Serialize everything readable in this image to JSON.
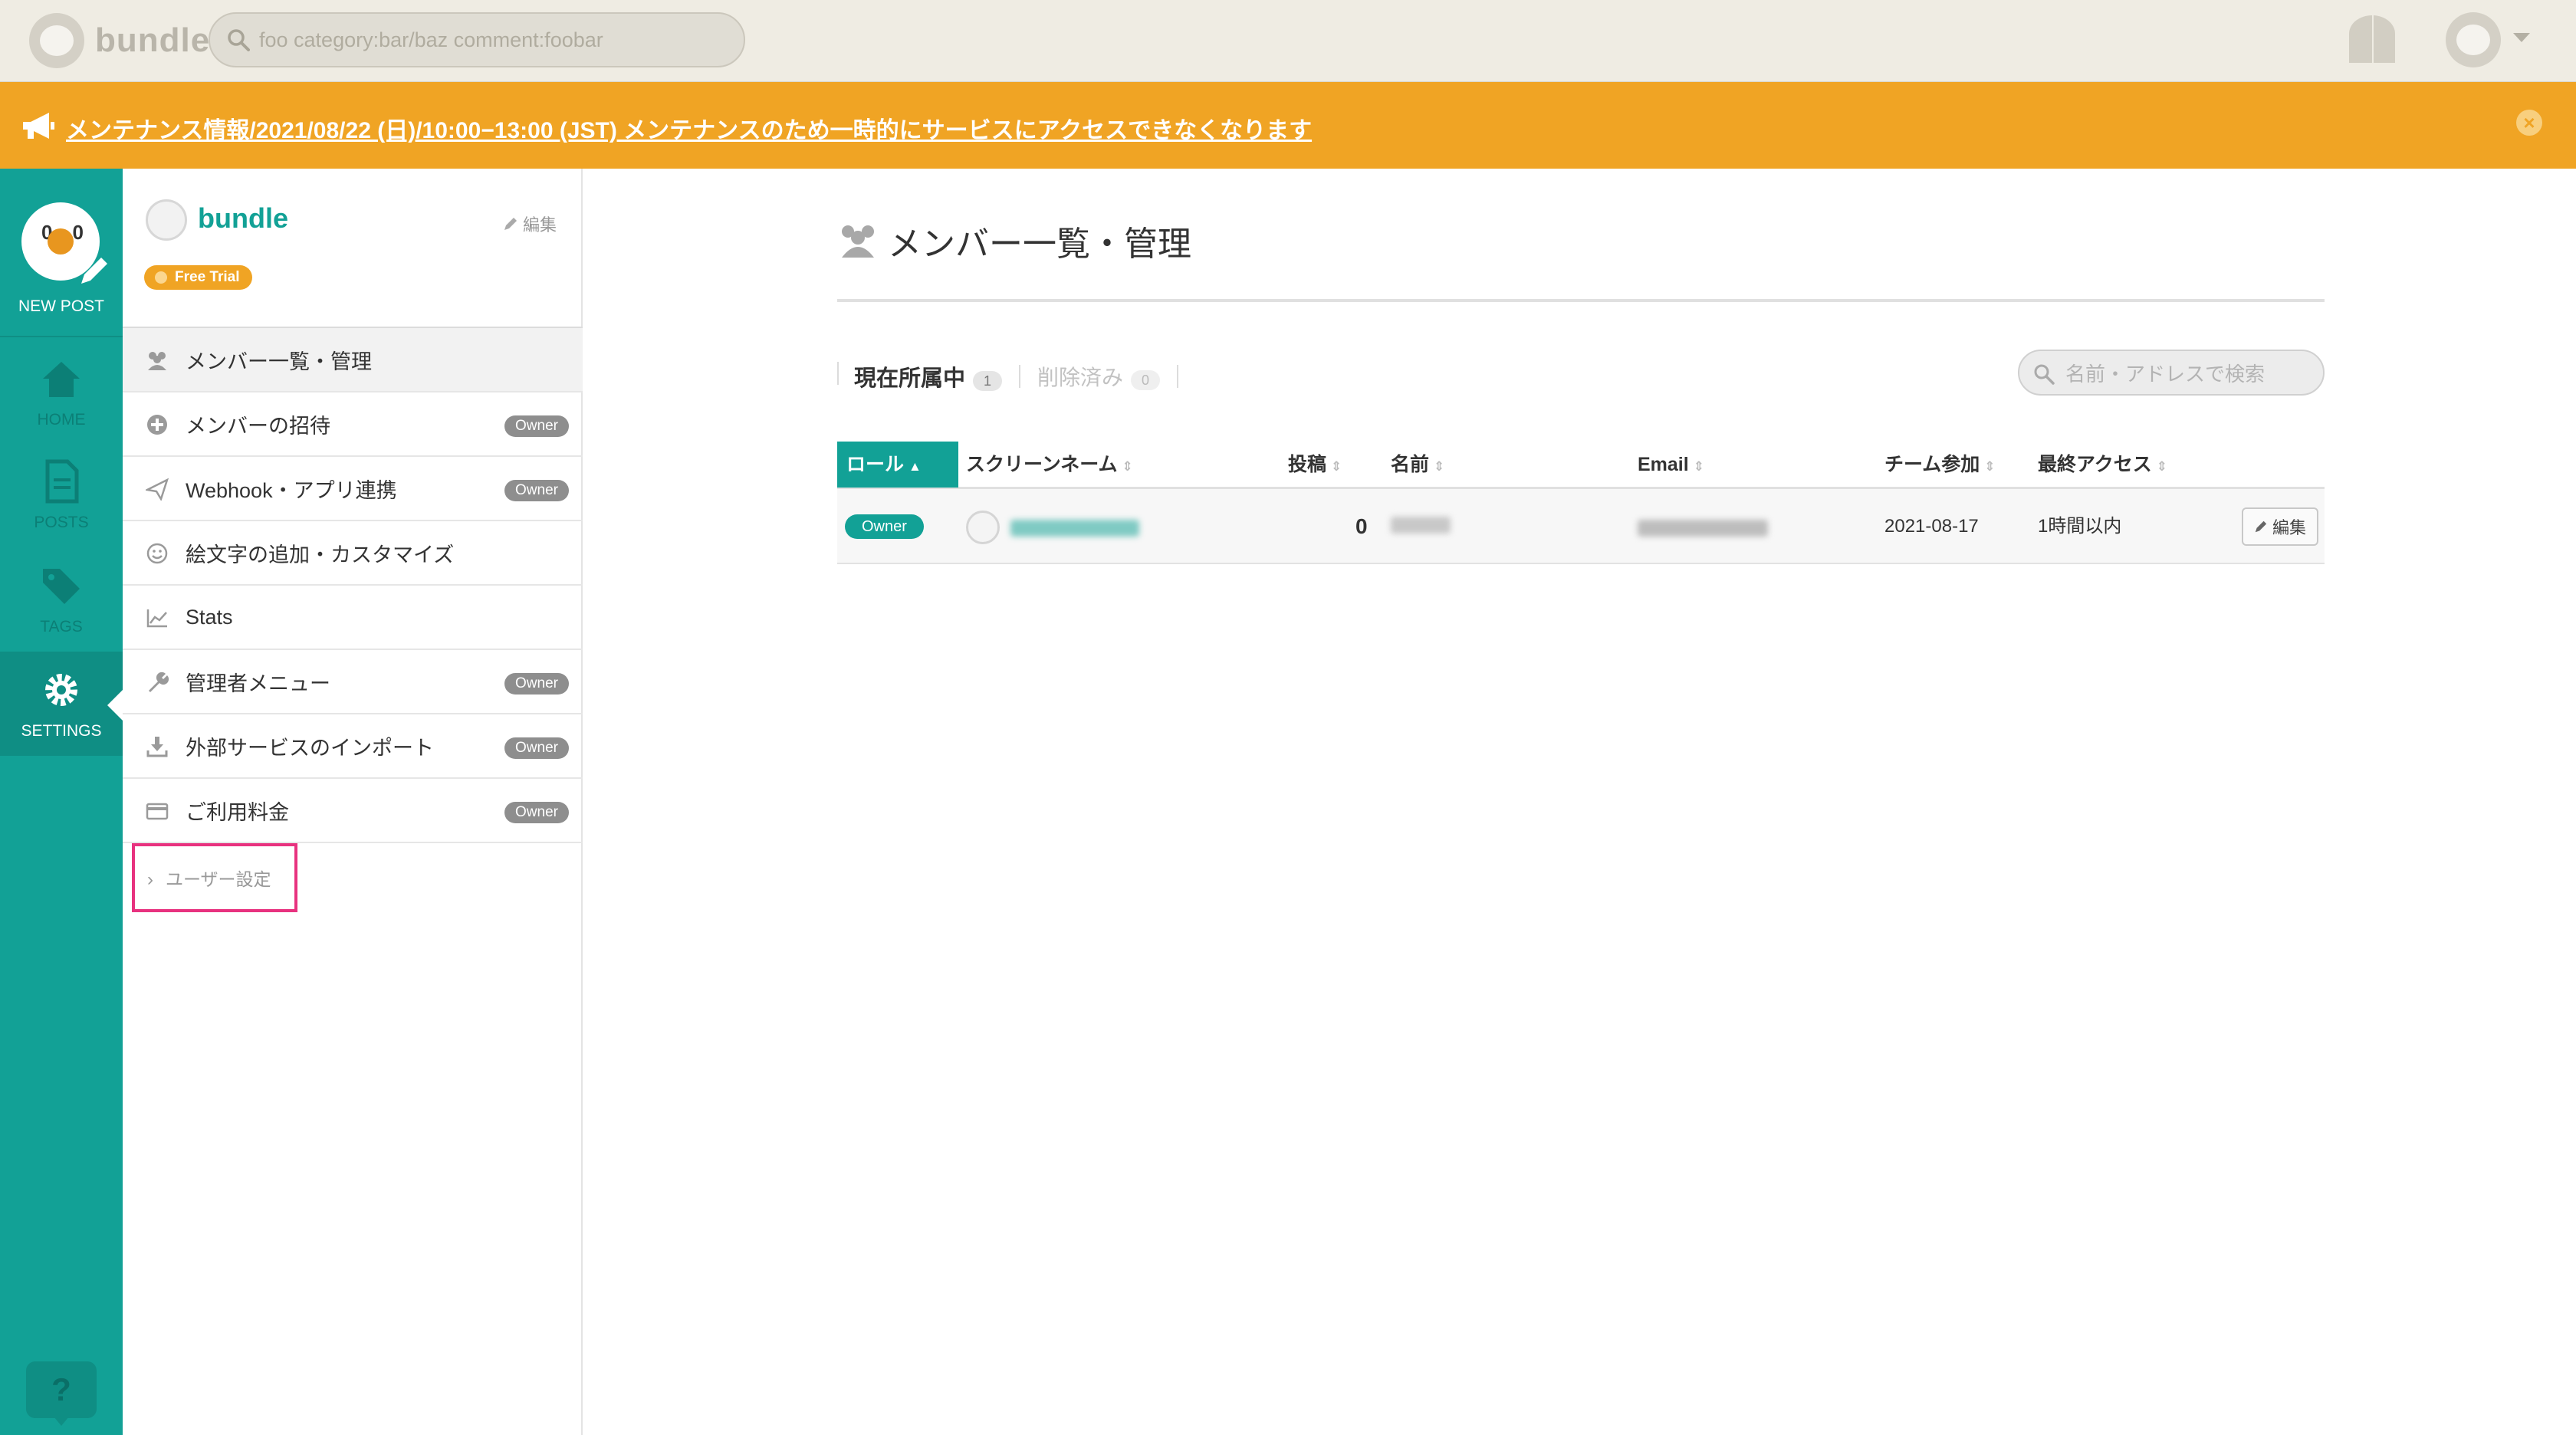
{
  "app": {
    "name": "bundle"
  },
  "topbar": {
    "search_placeholder": "foo category:bar/baz comment:foobar"
  },
  "banner": {
    "text": "メンテナンス情報/2021/08/22 (日)/10:00−13:00 (JST) メンテナンスのため一時的にサービスにアクセスできなくなります",
    "color": "#f0a424",
    "close_icon": "close-icon"
  },
  "rail": {
    "new_post": "NEW POST",
    "items": [
      {
        "label": "HOME",
        "icon": "home-icon"
      },
      {
        "label": "POSTS",
        "icon": "document-icon"
      },
      {
        "label": "TAGS",
        "icon": "tags-icon"
      },
      {
        "label": "SETTINGS",
        "icon": "gear-icon",
        "active": true
      }
    ],
    "help": "?",
    "accent": "#12a196"
  },
  "team": {
    "name": "bundle",
    "edit_label": "編集",
    "trial_badge": "Free Trial"
  },
  "menu": {
    "items": [
      {
        "label": "メンバー一覧・管理",
        "icon": "members-icon",
        "active": true
      },
      {
        "label": "メンバーの招待",
        "icon": "plus-circle-icon",
        "badge": "Owner"
      },
      {
        "label": "Webhook・アプリ連携",
        "icon": "paper-plane-icon",
        "badge": "Owner"
      },
      {
        "label": "絵文字の追加・カスタマイズ",
        "icon": "smiley-icon"
      },
      {
        "label": "Stats",
        "icon": "chart-icon"
      },
      {
        "label": "管理者メニュー",
        "icon": "wrench-icon",
        "badge": "Owner"
      },
      {
        "label": "外部サービスのインポート",
        "icon": "download-icon",
        "badge": "Owner"
      },
      {
        "label": "ご利用料金",
        "icon": "credit-card-icon",
        "badge": "Owner"
      }
    ],
    "user_settings": "ユーザー設定",
    "highlight_color": "#e8327f"
  },
  "main": {
    "title": "メンバー一覧・管理",
    "tabs": [
      {
        "label": "現在所属中",
        "count": "1",
        "active": true
      },
      {
        "label": "削除済み",
        "count": "0",
        "active": false
      }
    ],
    "search_placeholder": "名前・アドレスで検索",
    "table": {
      "columns": [
        "ロール",
        "スクリーンネーム",
        "投稿",
        "名前",
        "Email",
        "チーム参加",
        "最終アクセス"
      ],
      "rows": [
        {
          "role": "Owner",
          "screen_name": "",
          "posts": "0",
          "name": "",
          "email": "",
          "joined": "2021-08-17",
          "last_access": "1時間以内",
          "edit": "編集"
        }
      ]
    }
  }
}
